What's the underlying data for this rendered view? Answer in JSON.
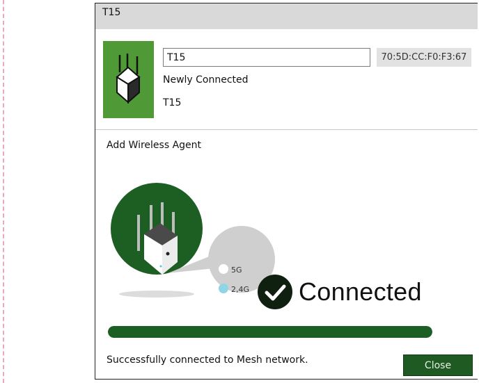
{
  "window": {
    "title": "T15"
  },
  "device": {
    "icon": "router-icon",
    "name_value": "T15",
    "mac": "70:5D:CC:F0:F3:67",
    "status": "Newly Connected",
    "model": "T15"
  },
  "agent": {
    "heading": "Add Wireless Agent",
    "bands": [
      {
        "label": "5G",
        "active": false
      },
      {
        "label": "2,4G",
        "active": true
      }
    ],
    "connection_label": "Connected",
    "progress_fraction": 1.0,
    "result_message": "Successfully connected to Mesh network."
  },
  "actions": {
    "close_label": "Close"
  },
  "colors": {
    "tile_green": "#4f9a36",
    "dark_green": "#1b5f24",
    "badge_gray": "#cfcfcf",
    "band_active": "#8fd5e6"
  }
}
